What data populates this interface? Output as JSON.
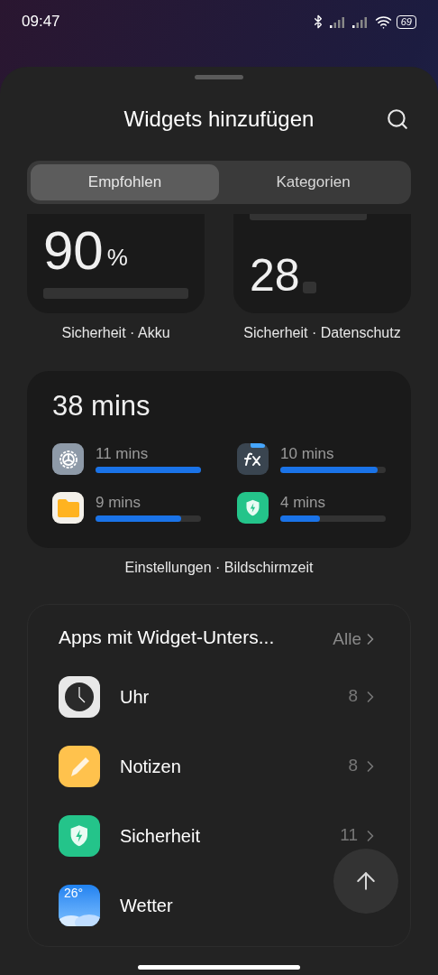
{
  "status_bar": {
    "time": "09:47",
    "battery": "69"
  },
  "sheet": {
    "title": "Widgets hinzufügen"
  },
  "tabs": [
    {
      "label": "Empfohlen",
      "selected": true
    },
    {
      "label": "Kategorien",
      "selected": false
    }
  ],
  "widgets": [
    {
      "kind": "battery",
      "value": "90",
      "unit": "%",
      "caption": "Sicherheit · Akku"
    },
    {
      "kind": "privacy",
      "value": "28",
      "caption": "Sicherheit · Datenschutz"
    }
  ],
  "screen_time": {
    "total": "38 mins",
    "caption": "Einstellungen · Bildschirmzeit",
    "apps": [
      {
        "kind": "gear",
        "time": "11 mins",
        "level": 1.0
      },
      {
        "kind": "fx",
        "time": "10 mins",
        "level": 0.92
      },
      {
        "kind": "folder",
        "time": "9 mins",
        "level": 0.81
      },
      {
        "kind": "shield",
        "time": "4 mins",
        "level": 0.38
      }
    ]
  },
  "apps_section": {
    "title": "Apps mit Widget-Unters...",
    "link": "Alle",
    "apps": [
      {
        "kind": "clock",
        "name": "Uhr",
        "count": "8"
      },
      {
        "kind": "notepad",
        "name": "Notizen",
        "count": "8"
      },
      {
        "kind": "shield",
        "name": "Sicherheit",
        "count": "11"
      },
      {
        "kind": "weather",
        "name": "Wetter",
        "badge": "26°"
      }
    ]
  }
}
